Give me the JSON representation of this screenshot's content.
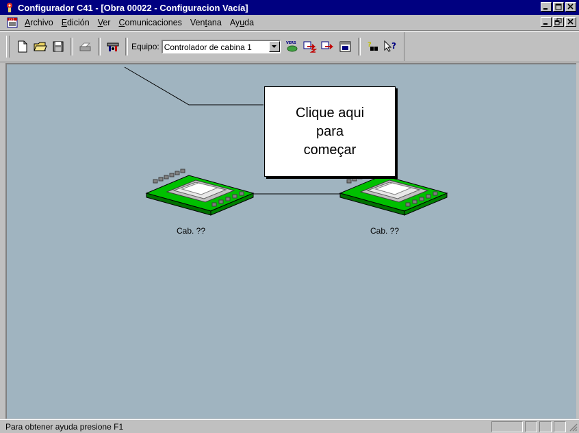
{
  "window": {
    "title": "Configurador C41 - [Obra 00022 - Configuracion Vacía]"
  },
  "menu": {
    "items": [
      {
        "label": "Archivo",
        "mnemonic": "A",
        "rest": "rchivo"
      },
      {
        "label": "Edición",
        "mnemonic": "E",
        "rest": "dición"
      },
      {
        "label": "Ver",
        "mnemonic": "V",
        "rest": "er"
      },
      {
        "label": "Comunicaciones",
        "mnemonic": "C",
        "rest": "omunicaciones"
      },
      {
        "label": "Ventana",
        "pre": "Ven",
        "mnemonic": "t",
        "rest": "ana"
      },
      {
        "label": "Ayuda",
        "pre": "Ay",
        "mnemonic": "u",
        "rest": "da"
      }
    ]
  },
  "toolbar": {
    "equipo_label": "Equipo:",
    "equipo_selected": "Controlador de cabina 1",
    "vers_icon_text": "VERS"
  },
  "canvas": {
    "nodes": [
      {
        "label": "Cab. ??"
      },
      {
        "label": "Cab. ??"
      }
    ],
    "callout": "Clique aqui\npara\ncomeçar"
  },
  "status": {
    "text": "Para obtener ayuda presione F1"
  },
  "colors": {
    "titlebar": "#000080",
    "workspace": "#a0b4c0",
    "board_green": "#00c000",
    "chrome": "#c0c0c0"
  }
}
